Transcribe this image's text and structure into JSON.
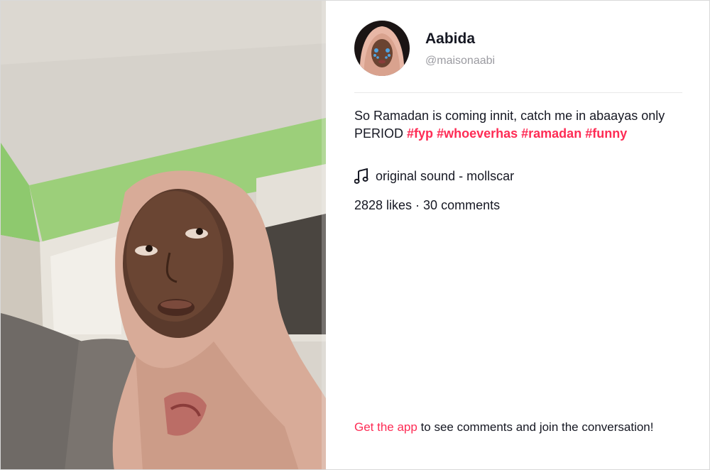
{
  "author": {
    "name": "Aabida",
    "handle": "@maisonaabi"
  },
  "caption": {
    "text": "So Ramadan is coming innit, catch me in abaayas only PERIOD",
    "hashtags": [
      "#fyp",
      "#whoeverhas",
      "#ramadan",
      "#funny"
    ]
  },
  "music": {
    "icon": "music-note-icon",
    "label": "original sound - mollscar"
  },
  "stats": {
    "text": "2828 likes · 30 comments"
  },
  "cta": {
    "link_text": "Get the app",
    "rest_text": " to see comments and join the conversation!"
  },
  "colors": {
    "accent": "#fe2c55",
    "text": "#161823",
    "muted": "#9b9ba1"
  }
}
